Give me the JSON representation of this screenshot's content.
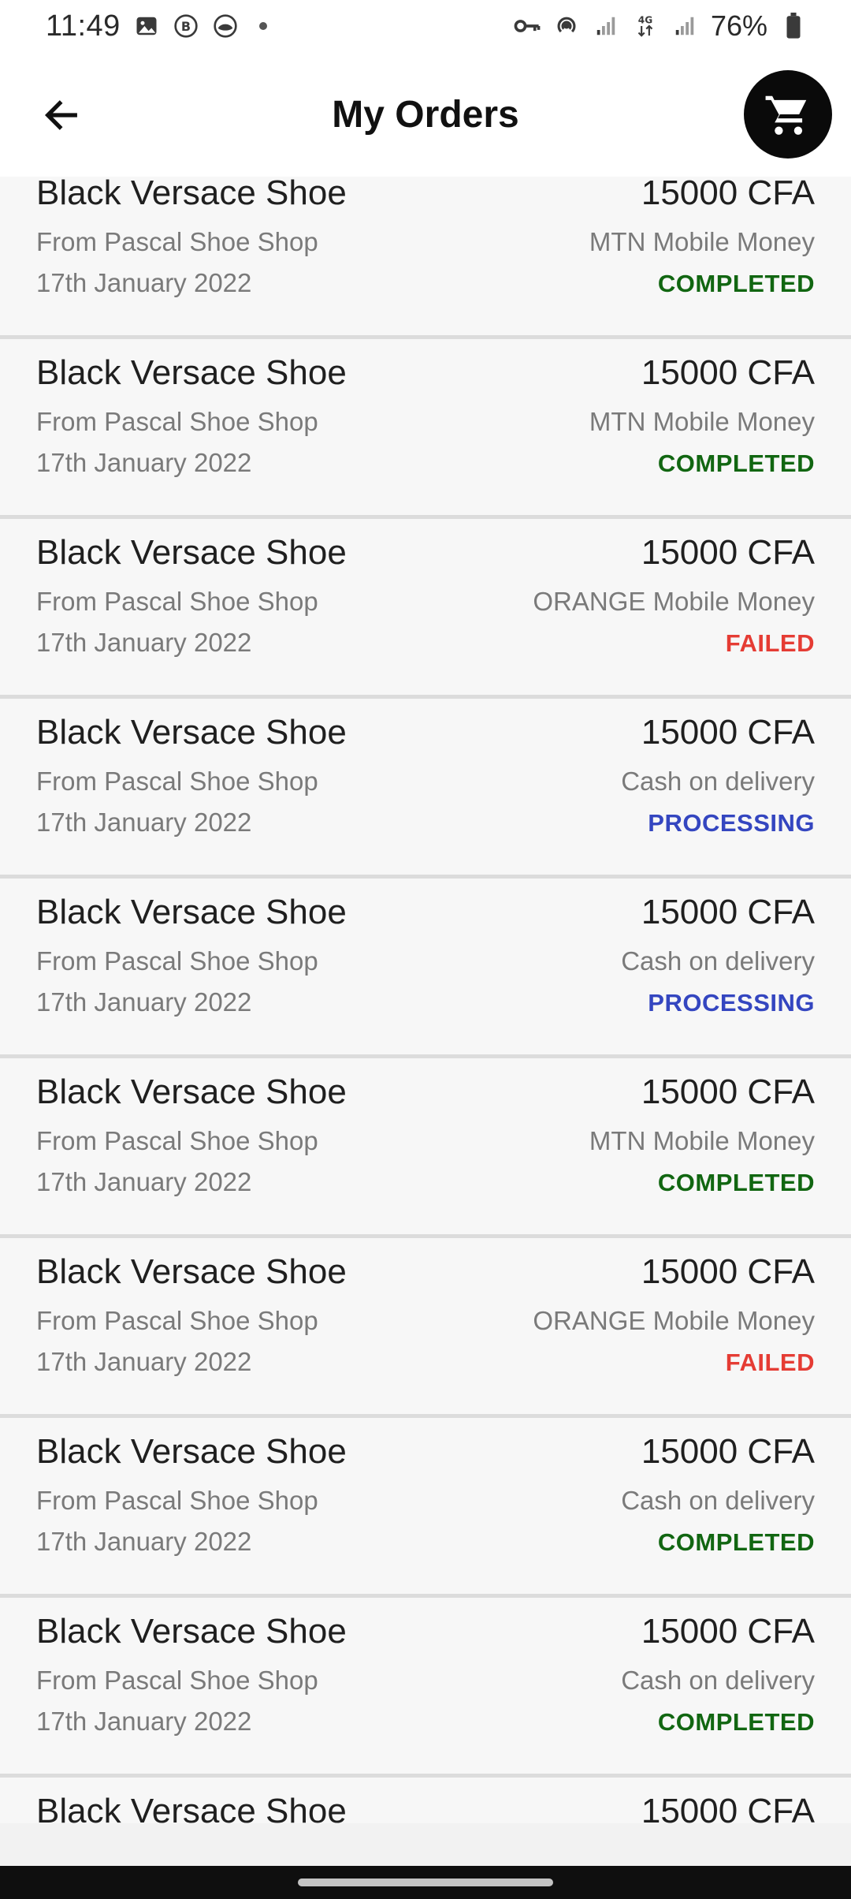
{
  "status_bar": {
    "time": "11:49",
    "battery": "76%",
    "network": "4G",
    "icons_left": [
      "image-icon",
      "b-circle-icon",
      "eye-circle-icon",
      "dot-icon"
    ],
    "icons_right": [
      "key-icon",
      "hotspot-icon",
      "signal-icon",
      "network-4g-icon",
      "signal-icon",
      "battery-icon"
    ]
  },
  "header": {
    "title": "My Orders",
    "back_icon": "arrow-left-icon",
    "cart_icon": "shopping-cart-icon"
  },
  "colors": {
    "completed": "#116611",
    "failed": "#e53c34",
    "processing": "#3446c0"
  },
  "orders": [
    {
      "product": "Black Versace Shoe",
      "price": "15000 CFA",
      "shop": "From Pascal Shoe Shop",
      "payment": "MTN Mobile Money",
      "date": "17th January 2022",
      "status": "COMPLETED",
      "status_type": "completed"
    },
    {
      "product": "Black Versace Shoe",
      "price": "15000 CFA",
      "shop": "From Pascal Shoe Shop",
      "payment": "MTN Mobile Money",
      "date": "17th January 2022",
      "status": "COMPLETED",
      "status_type": "completed"
    },
    {
      "product": "Black Versace Shoe",
      "price": "15000 CFA",
      "shop": "From Pascal Shoe Shop",
      "payment": "ORANGE Mobile Money",
      "date": "17th January 2022",
      "status": "FAILED",
      "status_type": "failed"
    },
    {
      "product": "Black Versace Shoe",
      "price": "15000 CFA",
      "shop": "From Pascal Shoe Shop",
      "payment": "Cash on delivery",
      "date": "17th January 2022",
      "status": "PROCESSING",
      "status_type": "processing"
    },
    {
      "product": "Black Versace Shoe",
      "price": "15000 CFA",
      "shop": "From Pascal Shoe Shop",
      "payment": "Cash on delivery",
      "date": "17th January 2022",
      "status": "PROCESSING",
      "status_type": "processing"
    },
    {
      "product": "Black Versace Shoe",
      "price": "15000 CFA",
      "shop": "From Pascal Shoe Shop",
      "payment": "MTN Mobile Money",
      "date": "17th January 2022",
      "status": "COMPLETED",
      "status_type": "completed"
    },
    {
      "product": "Black Versace Shoe",
      "price": "15000 CFA",
      "shop": "From Pascal Shoe Shop",
      "payment": "ORANGE Mobile Money",
      "date": "17th January 2022",
      "status": "FAILED",
      "status_type": "failed"
    },
    {
      "product": "Black Versace Shoe",
      "price": "15000 CFA",
      "shop": "From Pascal Shoe Shop",
      "payment": "Cash on delivery",
      "date": "17th January 2022",
      "status": "COMPLETED",
      "status_type": "completed"
    },
    {
      "product": "Black Versace Shoe",
      "price": "15000 CFA",
      "shop": "From Pascal Shoe Shop",
      "payment": "Cash on delivery",
      "date": "17th January 2022",
      "status": "COMPLETED",
      "status_type": "completed"
    },
    {
      "product": "Black Versace Shoe",
      "price": "15000 CFA",
      "shop": "",
      "payment": "",
      "date": "",
      "status": "",
      "status_type": "completed"
    }
  ]
}
